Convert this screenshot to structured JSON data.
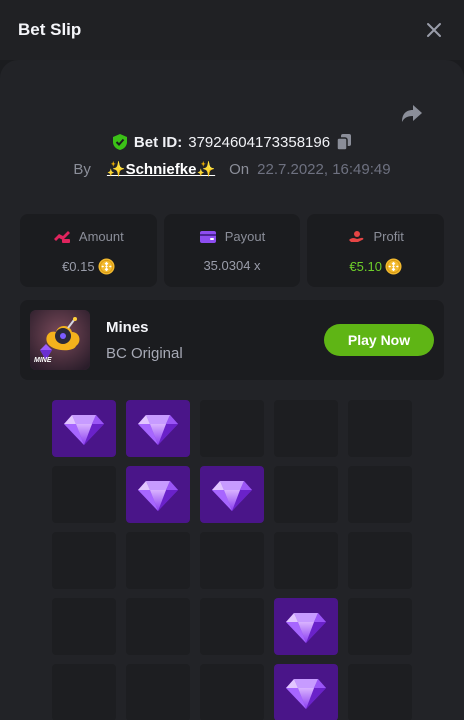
{
  "header": {
    "title": "Bet Slip"
  },
  "bet": {
    "id_label": "Bet ID:",
    "id_value": "37924604173358196",
    "by_label": "By",
    "user": "✨Schniefke✨",
    "on_label": "On",
    "date": "22.7.2022, 16:49:49"
  },
  "stats": {
    "amount": {
      "label": "Amount",
      "value": "€0.15"
    },
    "payout": {
      "label": "Payout",
      "value": "35.0304 x"
    },
    "profit": {
      "label": "Profit",
      "value": "€5.10"
    }
  },
  "game": {
    "name": "Mines",
    "subtitle": "BC Original",
    "thumb_text": "MINE",
    "play_label": "Play Now"
  },
  "grid": {
    "rows": 5,
    "cols": 5,
    "tiles": [
      "gem",
      "gem",
      "empty",
      "empty",
      "empty",
      "empty",
      "gem",
      "gem",
      "empty",
      "empty",
      "empty",
      "empty",
      "empty",
      "empty",
      "empty",
      "empty",
      "empty",
      "empty",
      "gem",
      "empty",
      "empty",
      "empty",
      "empty",
      "gem",
      "empty"
    ]
  },
  "colors": {
    "accent_green": "#5fb515",
    "profit_green": "#6ecf2a",
    "gem_tile": "#4a1589",
    "amount_icon": "#e0245e",
    "payout_icon": "#8d4df0",
    "profit_icon": "#e64545"
  },
  "icons": {
    "close": "close-icon",
    "share": "share-icon",
    "shield": "shield-check-icon",
    "copy": "copy-icon",
    "coin": "bnb-coin-icon",
    "gem": "diamond-icon"
  }
}
